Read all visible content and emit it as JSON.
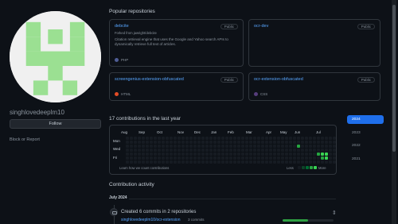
{
  "profile": {
    "username": "singhlovedeeplm10",
    "follow_label": "Follow",
    "block_label": "Block or Report"
  },
  "popular": {
    "title": "Popular repositories",
    "repos": [
      {
        "name": "debcite",
        "badge": "Public",
        "forked_prefix": "Forked from ",
        "forked_from": "jawright/debcite",
        "description": "Citation retrieval engine that uses the Google and Yahoo search APIs to dynamically retrieve full text of articles.",
        "language": "PHP",
        "language_color": "#4F5D95"
      },
      {
        "name": "ocr-dev",
        "badge": "Public",
        "forked_prefix": "",
        "forked_from": "",
        "description": "",
        "language": "",
        "language_color": ""
      },
      {
        "name": "screengenius-extension-obfuscated",
        "badge": "Public",
        "forked_prefix": "",
        "forked_from": "",
        "description": "",
        "language": "HTML",
        "language_color": "#e34c26"
      },
      {
        "name": "ocr-extension-obfuscated",
        "badge": "Public",
        "forked_prefix": "",
        "forked_from": "",
        "description": "",
        "language": "CSS",
        "language_color": "#563d7c"
      }
    ]
  },
  "contributions": {
    "title": "17 contributions in the last year",
    "months": [
      "Aug",
      "Sep",
      "Oct",
      "Nov",
      "Dec",
      "Jan",
      "Feb",
      "Mar",
      "Apr",
      "May",
      "Jun",
      "Jul"
    ],
    "days": [
      "Mon",
      "Wed",
      "Fri"
    ],
    "learn_link": "Learn how we count contributions",
    "legend_less": "Less",
    "legend_more": "More",
    "legend_colors": [
      "#161b22",
      "#0e4429",
      "#006d32",
      "#26a641",
      "#39d353"
    ],
    "active_cells": [
      {
        "week": 43,
        "day": 2,
        "level": 3
      },
      {
        "week": 48,
        "day": 4,
        "level": 3
      },
      {
        "week": 49,
        "day": 4,
        "level": 4
      },
      {
        "week": 49,
        "day": 5,
        "level": 3
      },
      {
        "week": 50,
        "day": 4,
        "level": 4
      },
      {
        "week": 50,
        "day": 5,
        "level": 4
      }
    ]
  },
  "years": [
    "2024",
    "2023",
    "2022",
    "2021"
  ],
  "active_year": "2024",
  "activity": {
    "title": "Contribution activity",
    "month_label": "July 2024",
    "event_title": "Created 6 commits in 2 repositories",
    "repo_link": "singhlovedeeplm10/ocr-extension",
    "commit_count": "3 commits",
    "bar_fraction": 0.5
  },
  "icons": {
    "commit": "repo-push-icon",
    "expand": "unfold-icon"
  }
}
